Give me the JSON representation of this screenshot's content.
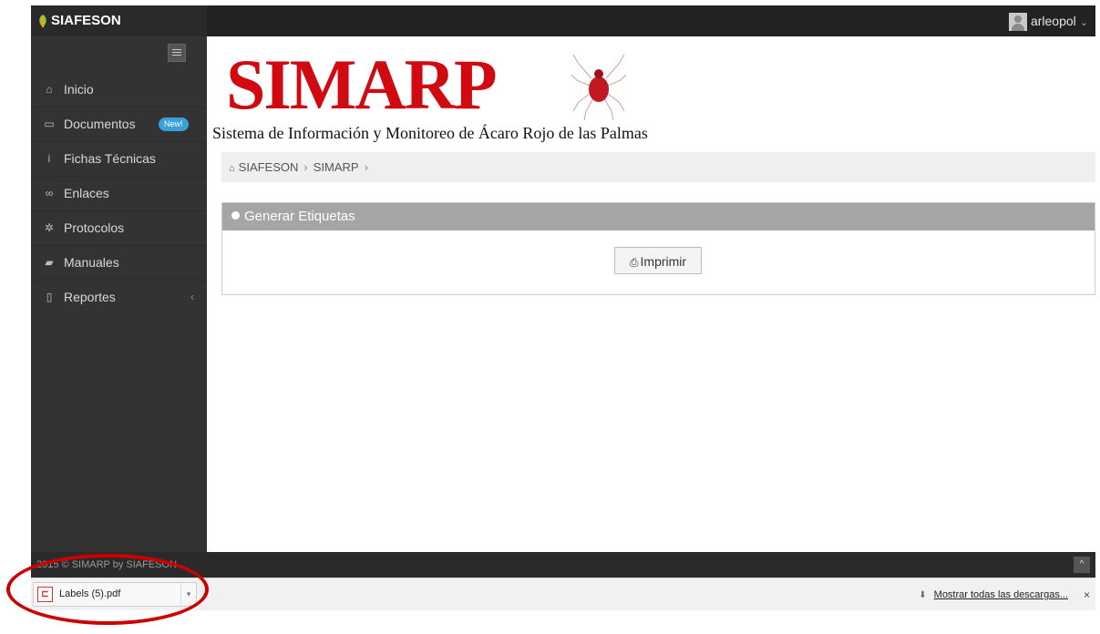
{
  "topbar": {
    "brand": "SIAFESON",
    "user": "arleopol",
    "user_chevron": "⌄"
  },
  "sidebar": {
    "toggle_icon": "hamburger-icon",
    "items": [
      {
        "label": "Inicio",
        "icon": "home-icon",
        "glyph": "⌂"
      },
      {
        "label": "Documentos",
        "icon": "folder-icon",
        "glyph": "▭",
        "badge": "New!"
      },
      {
        "label": "Fichas Técnicas",
        "icon": "info-icon",
        "glyph": "i"
      },
      {
        "label": "Enlaces",
        "icon": "link-icon",
        "glyph": "∞"
      },
      {
        "label": "Protocolos",
        "icon": "gear-icon",
        "glyph": "✲"
      },
      {
        "label": "Manuales",
        "icon": "book-icon",
        "glyph": "▰"
      },
      {
        "label": "Reportes",
        "icon": "file-icon",
        "glyph": "▯",
        "arrow": "‹"
      }
    ]
  },
  "main": {
    "logo_text": "SIMARP",
    "subtitle": "Sistema de Información y Monitoreo de Ácaro Rojo de las Palmas",
    "breadcrumb": {
      "home_glyph": "⌂",
      "items": [
        "SIAFESON",
        "SIMARP"
      ],
      "sep": "›"
    },
    "panel": {
      "title": "Generar Etiquetas",
      "button_label": "Imprimir",
      "button_glyph": "⎙"
    }
  },
  "footer": {
    "text": "2015 © SIMARP by SIAFESON",
    "to_top": "^"
  },
  "downloads": {
    "file": "Labels (5).pdf",
    "dropdown": "▾",
    "show_all": "Mostrar todas las descargas...",
    "close": "×"
  },
  "colors": {
    "brand_red": "#d10a12",
    "sidebar_bg": "#333333",
    "badge_blue": "#3aa1d8",
    "panel_header": "#a5a5a5",
    "annotation": "#cc0000"
  }
}
